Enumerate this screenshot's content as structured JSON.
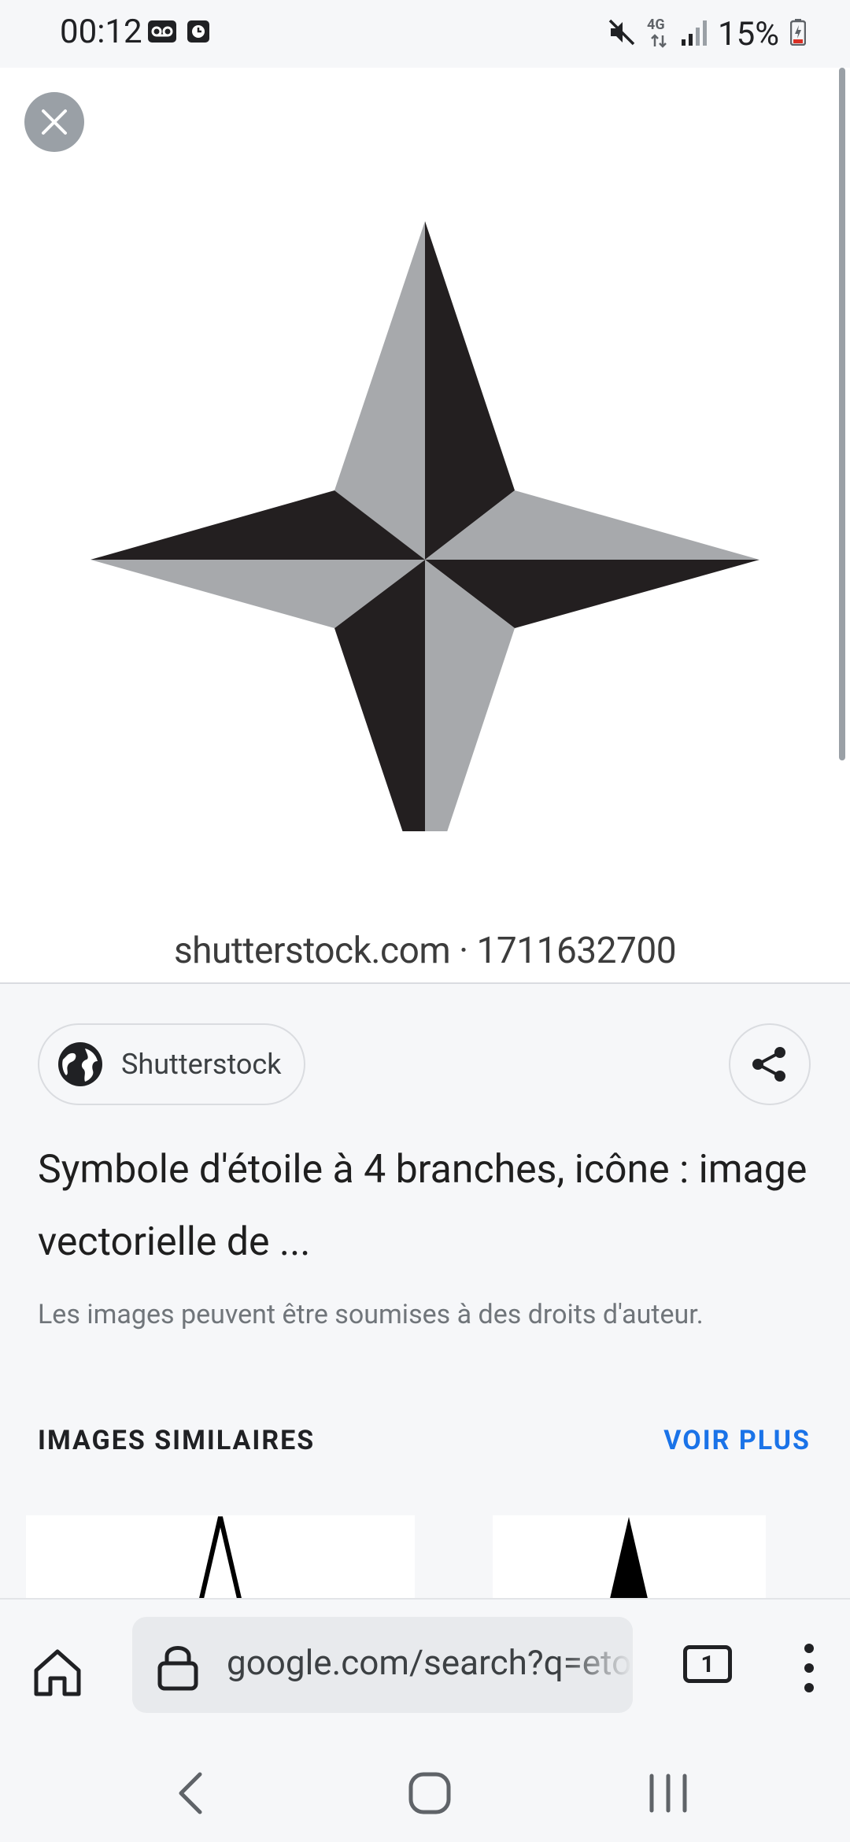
{
  "status_bar": {
    "time": "00:12",
    "network": "4G",
    "battery": "15%"
  },
  "image_viewer": {
    "close_icon": "close-icon",
    "watermark": "shutterstock.com · 1711632700",
    "colors": {
      "dark": "#231f20",
      "light": "#a7a9ac"
    }
  },
  "source": {
    "name": "Shutterstock",
    "icon": "globe-icon"
  },
  "result": {
    "title": "Symbole d'étoile à 4 branches, icône : image vectorielle de ...",
    "copyright": "Les images peuvent être soumises à des droits d'auteur."
  },
  "similar": {
    "title": "IMAGES SIMILAIRES",
    "more": "VOIR PLUS"
  },
  "browser": {
    "url": "google.com/search?q=etoile",
    "tab_count": "1"
  }
}
